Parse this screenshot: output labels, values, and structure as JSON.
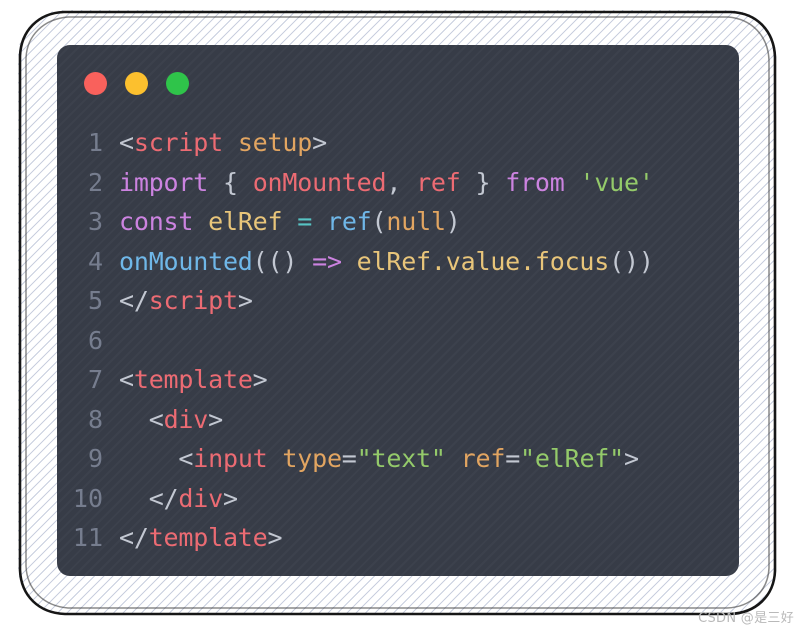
{
  "window": {
    "dots": [
      {
        "name": "close",
        "color": "#f9615c"
      },
      {
        "name": "minimize",
        "color": "#fcc02e"
      },
      {
        "name": "maximize",
        "color": "#2fc44a"
      }
    ]
  },
  "editor": {
    "language": "vue",
    "theme_background": "#383d49",
    "line_number_color": "#767d8e",
    "lines": [
      {
        "number": "1",
        "tokens": [
          {
            "text": "<",
            "kind": "punct"
          },
          {
            "text": "script",
            "kind": "tag"
          },
          {
            "text": " ",
            "kind": "plain"
          },
          {
            "text": "setup",
            "kind": "attr"
          },
          {
            "text": ">",
            "kind": "punct"
          }
        ]
      },
      {
        "number": "2",
        "tokens": [
          {
            "text": "import",
            "kind": "keyword"
          },
          {
            "text": " ",
            "kind": "plain"
          },
          {
            "text": "{",
            "kind": "punct"
          },
          {
            "text": " ",
            "kind": "plain"
          },
          {
            "text": "onMounted",
            "kind": "ident"
          },
          {
            "text": ",",
            "kind": "punct"
          },
          {
            "text": " ",
            "kind": "plain"
          },
          {
            "text": "ref",
            "kind": "ident"
          },
          {
            "text": " ",
            "kind": "plain"
          },
          {
            "text": "}",
            "kind": "punct"
          },
          {
            "text": " ",
            "kind": "plain"
          },
          {
            "text": "from",
            "kind": "keyword"
          },
          {
            "text": " ",
            "kind": "plain"
          },
          {
            "text": "'vue'",
            "kind": "string"
          }
        ]
      },
      {
        "number": "3",
        "tokens": [
          {
            "text": "const",
            "kind": "keyword"
          },
          {
            "text": " ",
            "kind": "plain"
          },
          {
            "text": "elRef",
            "kind": "var"
          },
          {
            "text": " ",
            "kind": "plain"
          },
          {
            "text": "=",
            "kind": "op"
          },
          {
            "text": " ",
            "kind": "plain"
          },
          {
            "text": "ref",
            "kind": "func"
          },
          {
            "text": "(",
            "kind": "punct"
          },
          {
            "text": "null",
            "kind": "const"
          },
          {
            "text": ")",
            "kind": "punct"
          }
        ]
      },
      {
        "number": "4",
        "tokens": [
          {
            "text": "onMounted",
            "kind": "func"
          },
          {
            "text": "(()",
            "kind": "punct"
          },
          {
            "text": " ",
            "kind": "plain"
          },
          {
            "text": "=>",
            "kind": "keyword"
          },
          {
            "text": " ",
            "kind": "plain"
          },
          {
            "text": "elRef.value.focus",
            "kind": "var"
          },
          {
            "text": "())",
            "kind": "punct"
          }
        ]
      },
      {
        "number": "5",
        "tokens": [
          {
            "text": "</",
            "kind": "punct"
          },
          {
            "text": "script",
            "kind": "tag"
          },
          {
            "text": ">",
            "kind": "punct"
          }
        ]
      },
      {
        "number": "6",
        "tokens": []
      },
      {
        "number": "7",
        "tokens": [
          {
            "text": "<",
            "kind": "punct"
          },
          {
            "text": "template",
            "kind": "tag"
          },
          {
            "text": ">",
            "kind": "punct"
          }
        ]
      },
      {
        "number": "8",
        "tokens": [
          {
            "text": "  <",
            "kind": "punct"
          },
          {
            "text": "div",
            "kind": "tag"
          },
          {
            "text": ">",
            "kind": "punct"
          }
        ]
      },
      {
        "number": "9",
        "tokens": [
          {
            "text": "    <",
            "kind": "punct"
          },
          {
            "text": "input",
            "kind": "tag"
          },
          {
            "text": " ",
            "kind": "plain"
          },
          {
            "text": "type",
            "kind": "attr"
          },
          {
            "text": "=",
            "kind": "punct"
          },
          {
            "text": "\"text\"",
            "kind": "string"
          },
          {
            "text": " ",
            "kind": "plain"
          },
          {
            "text": "ref",
            "kind": "attr"
          },
          {
            "text": "=",
            "kind": "punct"
          },
          {
            "text": "\"elRef\"",
            "kind": "string"
          },
          {
            "text": ">",
            "kind": "punct"
          }
        ]
      },
      {
        "number": "10",
        "tokens": [
          {
            "text": "  </",
            "kind": "punct"
          },
          {
            "text": "div",
            "kind": "tag"
          },
          {
            "text": ">",
            "kind": "punct"
          }
        ]
      },
      {
        "number": "11",
        "tokens": [
          {
            "text": "</",
            "kind": "punct"
          },
          {
            "text": "template",
            "kind": "tag"
          },
          {
            "text": ">",
            "kind": "punct"
          }
        ]
      }
    ]
  },
  "watermark": {
    "text": "CSDN @是三好"
  }
}
